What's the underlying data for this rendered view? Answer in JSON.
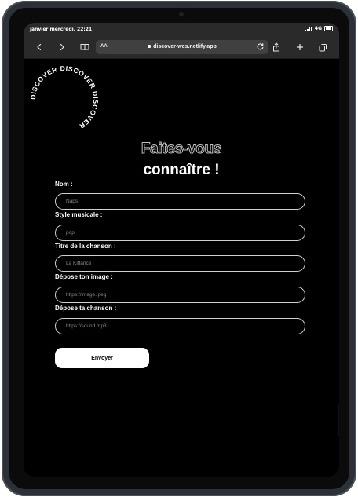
{
  "status_bar": {
    "time": "janvier mercredi, 22:21",
    "network": "4G"
  },
  "browser": {
    "text_size_label": "AA",
    "url": "discover-wcs.netlify.app",
    "icons": [
      "back-icon",
      "forward-icon",
      "bookmarks-icon",
      "reload-icon",
      "share-icon",
      "new-tab-icon",
      "tabs-icon"
    ]
  },
  "logo": {
    "circular_text": "DISCOVER DISCOVER DISCOVER "
  },
  "heading": {
    "line1": "Faites-vous",
    "line2": "connaître !"
  },
  "form": {
    "fields": [
      {
        "label": "Nom :",
        "placeholder": "Naps"
      },
      {
        "label": "Style musicale :",
        "placeholder": "pop"
      },
      {
        "label": "Titre de la chanson :",
        "placeholder": "La Kiffance"
      },
      {
        "label": "Dépose ton image :",
        "placeholder": "https://image.jpeg"
      },
      {
        "label": "Dépose ta chanson :",
        "placeholder": "https://sound.mp3"
      }
    ],
    "submit_label": "Envoyer"
  },
  "colors": {
    "page_background": "#000000",
    "browser_chrome": "#2a2a2a",
    "field_border": "#d0d0d0",
    "button_background": "#ffffff"
  }
}
